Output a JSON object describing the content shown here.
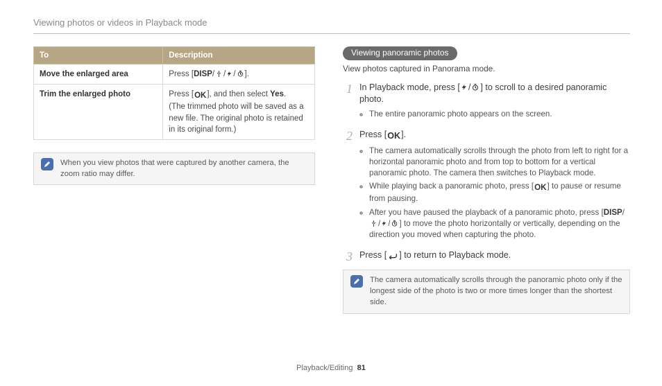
{
  "pageTitle": "Viewing photos or videos in Playback mode",
  "table": {
    "header": {
      "c0": "To",
      "c1": "Description"
    },
    "rows": [
      {
        "label": "Move the enlarged area",
        "desc_prefix": "Press [",
        "desc_disp": "DISP",
        "desc_suffix": "]."
      },
      {
        "label": "Trim the enlarged photo",
        "line1_prefix": "Press [",
        "line1_mid": "], and then select ",
        "select_yes": "Yes",
        "line1_suffix": ".",
        "line2": "(The trimmed photo will be saved as a new file. The original photo is retained in its original form.)"
      }
    ]
  },
  "leftNote": "When you view photos that were captured by another camera, the zoom ratio may differ.",
  "right": {
    "pill": "Viewing panoramic photos",
    "intro": "View photos captured in Panorama mode.",
    "steps": [
      {
        "n": "1",
        "text_a": "In Playback mode, press [",
        "text_b": "] to scroll to a desired panoramic photo.",
        "bullets": [
          "The entire panoramic photo appears on the screen."
        ]
      },
      {
        "n": "2",
        "text_a": "Press [",
        "text_b": "].",
        "bullets": [
          "The camera automatically scrolls through the photo from left to right for a horizontal panoramic photo and from top to bottom for a vertical panoramic photo. The camera then switches to Playback mode.",
          "__b2__",
          "__b3__"
        ],
        "b2_a": "While playing back a panoramic photo, press [",
        "b2_b": "] to pause or resume from pausing.",
        "b3_a": "After you have paused the playback of a panoramic photo, press [",
        "b3_disp": "DISP",
        "b3_b": "] to move the photo horizontally or vertically, depending on the direction you moved when capturing the photo."
      },
      {
        "n": "3",
        "text_a": "Press [",
        "text_b": "] to return to Playback mode."
      }
    ],
    "note": "The camera automatically scrolls through the panoramic photo only if the longest side of the photo is two or more times longer than the shortest side."
  },
  "footer": {
    "section": "Playback/Editing",
    "page": "81"
  }
}
